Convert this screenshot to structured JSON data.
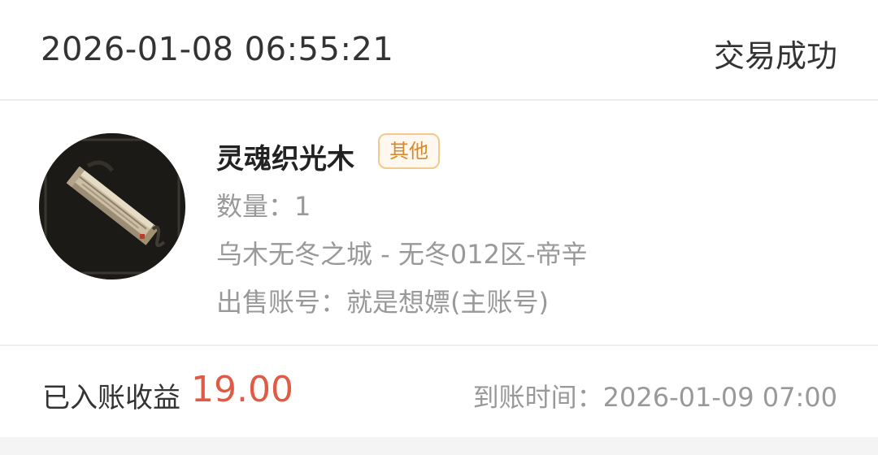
{
  "order": {
    "datetime": "2026-01-08 06:55:21",
    "status": "交易成功"
  },
  "item": {
    "image_icon": "wood-plank-icon",
    "name": "灵魂织光木",
    "tag": "其他",
    "quantity": "数量：1",
    "server": "乌木无冬之城 - 无冬012区-帝辛",
    "seller": "出售账号：就是想嫖(主账号)"
  },
  "earnings": {
    "label": "已入账收益",
    "amount": "19.00",
    "arrival": "到账时间：2026-01-09 07:00"
  },
  "colors": {
    "amount": "#e05a45",
    "tag_text": "#d9892b",
    "tag_border": "#f0c98f",
    "muted_text": "#999999"
  }
}
